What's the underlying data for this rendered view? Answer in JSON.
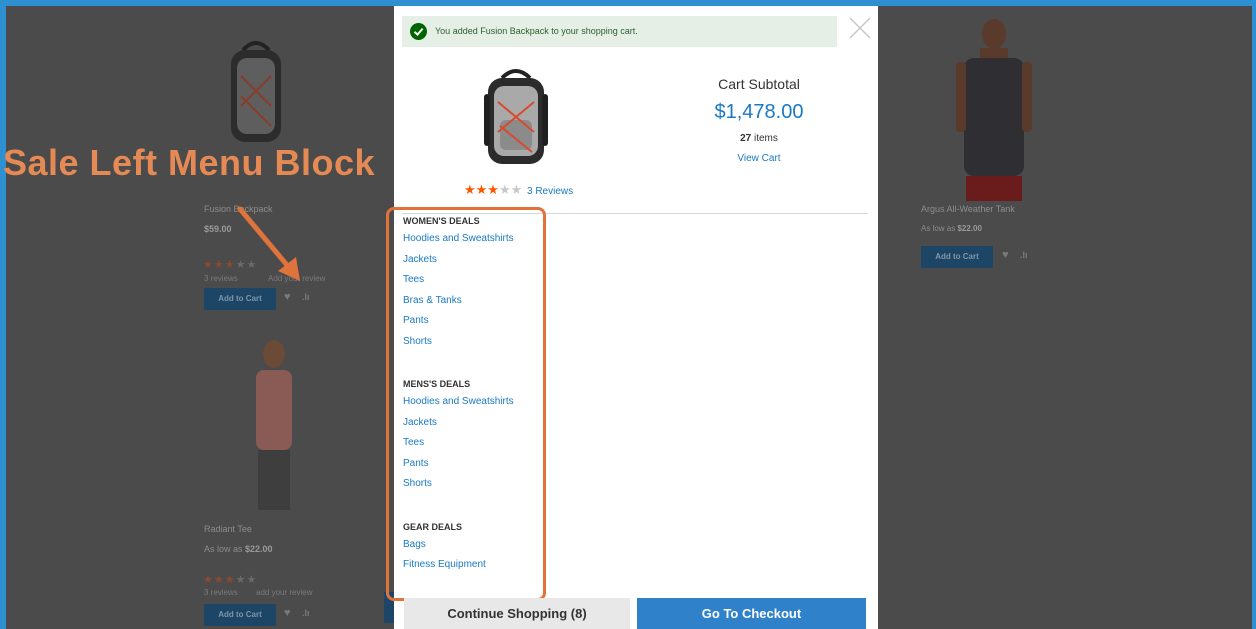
{
  "annotation": {
    "text": "Sale Left Menu Block"
  },
  "background_products": [
    {
      "name": "Fusion Backpack",
      "price": "$59.00",
      "reviews": "3 reviews",
      "add_review": "Add your review",
      "cart_label": "Add to Cart"
    },
    {
      "name": "Radiant Tee",
      "price_prefix": "As low as",
      "price": "$22.00",
      "reviews": "3 reviews",
      "add_review": "add your review",
      "cart_label": "Add to Cart"
    },
    {
      "name": "Argus All-Weather Tank",
      "price_prefix": "As low as",
      "price": "$22.00",
      "cart_label": "Add to Cart"
    }
  ],
  "modal": {
    "success_message": "You added Fusion Backpack to your shopping cart.",
    "rating": {
      "stars": 3,
      "max": 5,
      "label": "3 Reviews"
    },
    "subtotal": {
      "title": "Cart Subtotal",
      "amount": "$1,478.00",
      "items_count": "27",
      "items_label": "items",
      "view_cart": "View Cart"
    },
    "menu": [
      {
        "heading": "WOMEN'S DEALS",
        "links": [
          "Hoodies and Sweatshirts",
          "Jackets",
          "Tees",
          "Bras & Tanks",
          "Pants",
          "Shorts"
        ]
      },
      {
        "heading": "MENS'S DEALS",
        "links": [
          "Hoodies and Sweatshirts",
          "Jackets",
          "Tees",
          "Pants",
          "Shorts"
        ]
      },
      {
        "heading": "GEAR DEALS",
        "links": [
          "Bags",
          "Fitness Equipment"
        ]
      }
    ],
    "buttons": {
      "continue": "Continue Shopping (8)",
      "checkout": "Go To Checkout"
    }
  },
  "colors": {
    "accent": "#1979c3",
    "annotation": "#e0733c",
    "stars": "#ff5501",
    "success_bg": "#e5efe5"
  }
}
